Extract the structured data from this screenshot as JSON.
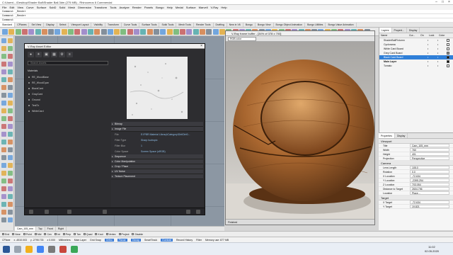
{
  "window": {
    "title": "C:\\Users\\...\\Desktop\\Shader Ball\\Shader Ball.3dm (275 MB) - Rhinoceros 6 Commercial"
  },
  "menu": [
    "File",
    "Edit",
    "View",
    "Curve",
    "Surface",
    "SubD",
    "Solid",
    "Mesh",
    "Dimension",
    "Transform",
    "Tools",
    "Analyze",
    "Render",
    "Panels",
    "Bongo",
    "Help",
    "Medal",
    "Surface",
    "Marvell",
    "V-Ray",
    "Help"
  ],
  "command_lines": [
    "Command: _Render",
    "Command: _Render",
    "Command:"
  ],
  "toolbar_tabs": [
    "Standard",
    "CPlanes",
    "Set View",
    "Display",
    "Select",
    "Viewport Layout",
    "Visibility",
    "Transform",
    "Curve Tools",
    "Surface Tools",
    "Solid Tools",
    "Mesh Tools",
    "Render Tools",
    "Drafting",
    "New in V6",
    "Bongo",
    "Bongo View",
    "Bongo Object Animation",
    "Bongo Utilities",
    "Bongo Value Animation"
  ],
  "asset_editor": {
    "title": "V-Ray Asset Editor",
    "search_placeholder": "Search Assets",
    "materials_label": "Materials",
    "materials": [
      "RE_WoodBase",
      "RE_WoodCyan",
      "BlackCard",
      "GrayCard",
      "Ground",
      "TestTx",
      "WhiteCard"
    ],
    "bitmap_header": "Bitmap",
    "image_file_header": "Image File",
    "file_label": "File",
    "file_value": "E:\\PBR Material Library\\Category\\Dirt\\Dirt0...",
    "filter_type_label": "Filter Type",
    "filter_type_value": "Sharp Isotropic",
    "filter_blur_label": "Filter Blur",
    "filter_blur_value": "1",
    "color_space_label": "Color Space",
    "color_space_value": "Screen Space (sRGB)",
    "sections": [
      "Sequence",
      "Color Manipulation",
      "Crop / Place",
      "UV Noise",
      "Texture Placement"
    ]
  },
  "frame_buffer": {
    "title": "V-Ray frame buffer - [34% of 378 x 700]",
    "channel": "RGB color",
    "status": "Finished"
  },
  "layers": {
    "tabs": [
      "Layers",
      "Propert...",
      "Display"
    ],
    "columns": [
      "Name",
      "Cur...",
      "On",
      "Lock",
      "Color"
    ],
    "rows": [
      "ShaderBallFixturnn",
      "Cyclorama",
      "White Card Board",
      "Grey Card Board",
      "Black Card Board",
      "Main Layer",
      "Tomato"
    ],
    "current_index": 4
  },
  "properties": {
    "tabs": [
      "Properties",
      "Display"
    ],
    "viewport_header": "Viewport",
    "viewport": [
      {
        "label": "Title",
        "value": "Cam_105_mm"
      },
      {
        "label": "Width",
        "value": "760"
      },
      {
        "label": "Height",
        "value": "401"
      },
      {
        "label": "Projection",
        "value": "Perspective"
      }
    ],
    "camera_header": "Camera",
    "camera": [
      {
        "label": "Lens Length",
        "value": "105.0"
      },
      {
        "label": "Rotation",
        "value": "0.0"
      },
      {
        "label": "X Location",
        "value": "-72.634"
      },
      {
        "label": "Y Location",
        "value": "-2395.254"
      },
      {
        "label": "Z Location",
        "value": "703.054"
      },
      {
        "label": "Distance to Target",
        "value": "2604.796"
      },
      {
        "label": "Location",
        "value": "Place..."
      }
    ],
    "target_header": "Target",
    "target": [
      {
        "label": "X Target",
        "value": "-72.634"
      },
      {
        "label": "Y Target",
        "value": "19.821"
      }
    ]
  },
  "viewport_tabs": [
    "Cam_105_mm",
    "Top",
    "Front",
    "Right"
  ],
  "osnaps": [
    "End",
    "Near",
    "Point",
    "Mid",
    "Cen",
    "Int",
    "Perp",
    "Tan",
    "Quad",
    "Knot",
    "Vertex",
    "Project",
    "Disable"
  ],
  "status_bar": {
    "items": [
      "CPlane",
      "x -4510.003",
      "y -2795.733",
      "z 0.000",
      "Millimeters",
      "Main Layer",
      "Grid Snap",
      "Ortho",
      "Planar",
      "Osnap",
      "SmartTrack",
      "Gumball",
      "Record History",
      "Filter",
      "Memory use: 877 MB"
    ],
    "highlighted": [
      "Ortho",
      "Planar",
      "Osnap",
      "Gumball"
    ]
  },
  "clock": {
    "time": "11:02",
    "date": "02.05.2020"
  }
}
